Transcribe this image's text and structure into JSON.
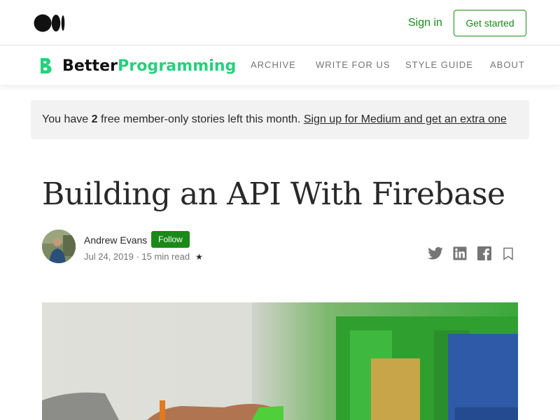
{
  "topbar": {
    "logo_icon": "medium-logo-icon",
    "sign_in": "Sign in",
    "get_started": "Get started",
    "accent": "#1a8917"
  },
  "publication": {
    "mark_icon": "better-programming-b-icon",
    "name_part1": "Better",
    "name_part2": "Programming",
    "name_color": "#26d07c",
    "nav": [
      "ARCHIVE",
      "WRITE FOR US",
      "STYLE GUIDE",
      "ABOUT"
    ]
  },
  "banner": {
    "prefix": "You have ",
    "count": "2",
    "suffix": " free member-only stories left this month. ",
    "link": "Sign up for Medium and get an extra one"
  },
  "article": {
    "title": "Building an API With Firebase",
    "author": "Andrew Evans",
    "follow": "Follow",
    "date": "Jul 24, 2019",
    "separator": " · ",
    "read_time": "15 min read",
    "member_star": "★"
  },
  "share_icons": [
    "twitter-icon",
    "linkedin-icon",
    "facebook-icon",
    "bookmark-icon"
  ]
}
